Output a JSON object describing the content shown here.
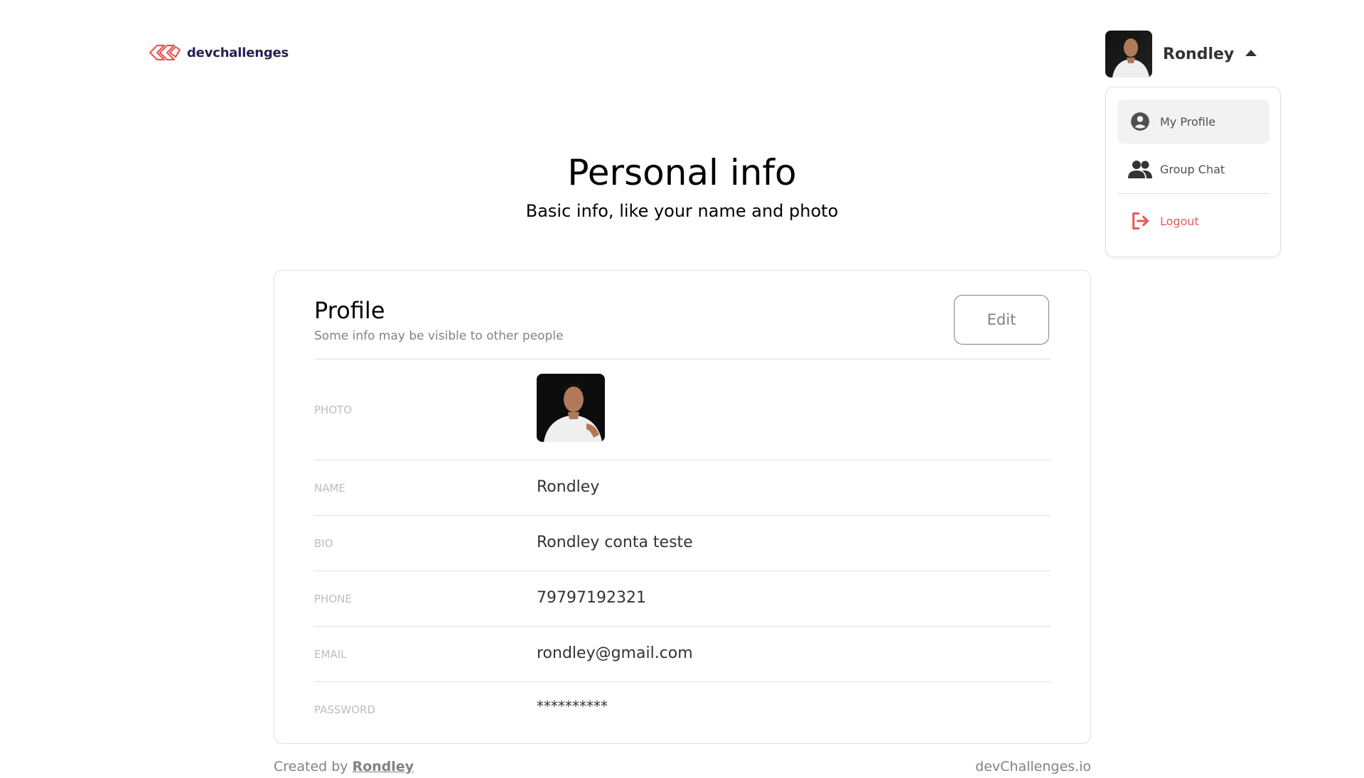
{
  "header": {
    "logo_text": "devchallenges",
    "user_name": "Rondley"
  },
  "dropdown": {
    "items": [
      {
        "label": "My Profile",
        "icon": "account-circle-icon"
      },
      {
        "label": "Group Chat",
        "icon": "group-icon"
      },
      {
        "label": "Logout",
        "icon": "logout-icon"
      }
    ]
  },
  "page": {
    "title": "Personal info",
    "subtitle": "Basic info, like your name and photo"
  },
  "profile": {
    "title": "Profile",
    "subtitle": "Some info may be visible to other people",
    "edit_label": "Edit",
    "rows": [
      {
        "label": "PHOTO",
        "value": ""
      },
      {
        "label": "NAME",
        "value": "Rondley"
      },
      {
        "label": "BIO",
        "value": "Rondley conta teste"
      },
      {
        "label": "PHONE",
        "value": "79797192321"
      },
      {
        "label": "EMAIL",
        "value": "rondley@gmail.com"
      },
      {
        "label": "PASSWORD",
        "value": "**********"
      }
    ]
  },
  "footer": {
    "created_by_prefix": "Created by",
    "created_by_name": "Rondley",
    "site": "devChallenges.io"
  },
  "colors": {
    "accent_red": "#eb5757",
    "text_dark": "#333333",
    "text_muted": "#828282",
    "border": "#e0e0e0"
  }
}
